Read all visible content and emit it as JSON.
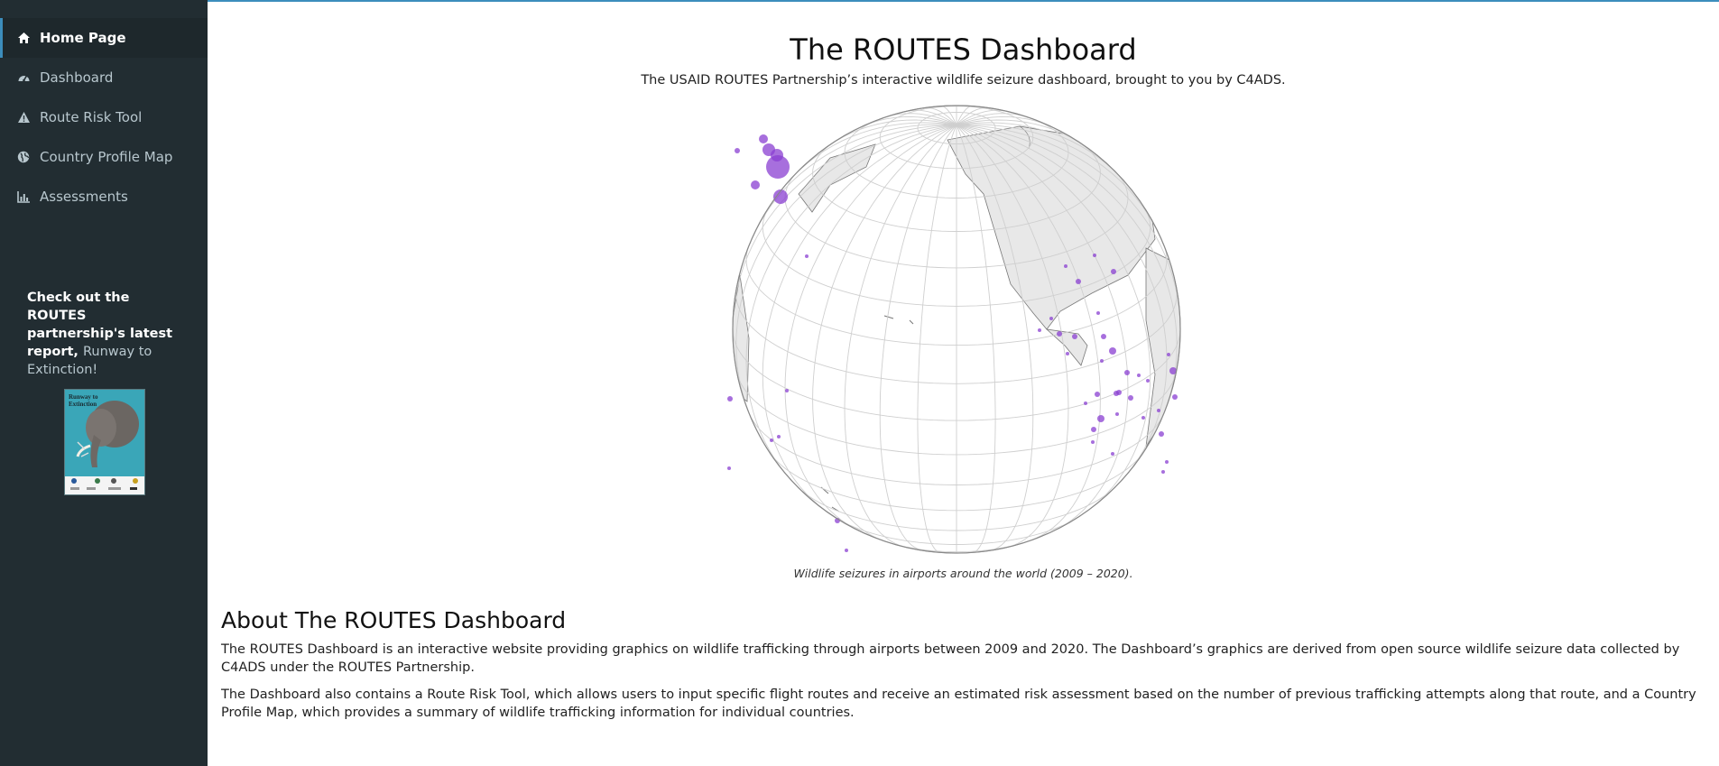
{
  "sidebar": {
    "items": [
      {
        "label": "Home Page",
        "icon": "home-icon"
      },
      {
        "label": "Dashboard",
        "icon": "dashboard-icon"
      },
      {
        "label": "Route Risk Tool",
        "icon": "warning-icon"
      },
      {
        "label": "Country Profile Map",
        "icon": "globe-icon"
      },
      {
        "label": "Assessments",
        "icon": "bar-chart-icon"
      }
    ],
    "promo": {
      "text": "Check out the ROUTES partnership's latest report,",
      "link": "Runway to Extinction!"
    },
    "report_cover": {
      "title_line1": "Runway to",
      "title_line2": "Extinction"
    }
  },
  "main": {
    "title": "The ROUTES Dashboard",
    "subtitle": "The USAID ROUTES Partnership’s interactive wildlife seizure dashboard, brought to you by C4ADS.",
    "globe_caption": "Wildlife seizures in airports around the world (2009 – 2020).",
    "about_heading": "About The ROUTES Dashboard",
    "about_p1": "The ROUTES Dashboard is an interactive website providing graphics on wildlife trafficking through airports between 2009 and 2020. The Dashboard’s graphics are derived from open source wildlife seizure data collected by C4ADS under the ROUTES Partnership.",
    "about_p2": "The Dashboard also contains a Route Risk Tool, which allows users to input specific flight routes and receive an estimated risk assessment based on the number of previous trafficking attempts along that route, and a Country Profile Map, which provides a summary of wildlife trafficking information for individual countries."
  },
  "colors": {
    "sidebar_bg": "#222d32",
    "active_bg": "#1e282c",
    "accent": "#3c8dbc",
    "marker": "#8a3fd1"
  }
}
